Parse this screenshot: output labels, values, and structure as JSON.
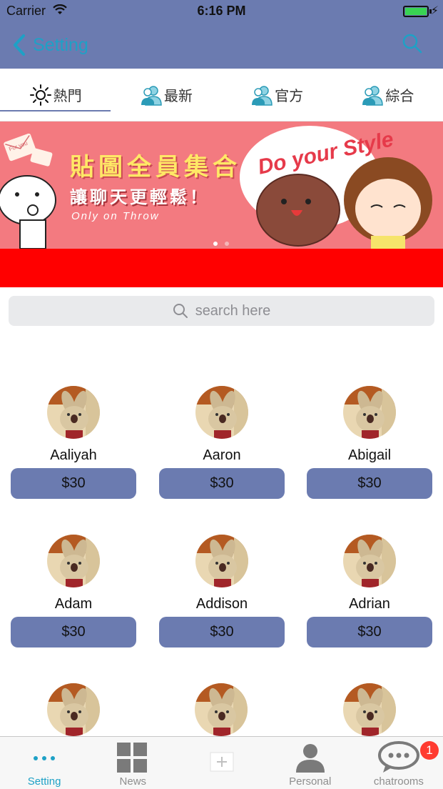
{
  "status_bar": {
    "carrier": "Carrier",
    "time": "6:16 PM"
  },
  "nav": {
    "back_label": "Setting"
  },
  "tabs": [
    {
      "label": "熱門",
      "icon": "sun-icon"
    },
    {
      "label": "最新",
      "icon": "users-icon"
    },
    {
      "label": "官方",
      "icon": "users-icon"
    },
    {
      "label": "綜合",
      "icon": "users-icon"
    }
  ],
  "banner": {
    "headline": "貼圖全員集合",
    "subline": "讓聊天更輕鬆！",
    "tagline": "Only on Throw",
    "bubble_text": "Do your Style",
    "envelope_text": "For you"
  },
  "search": {
    "placeholder": "search here"
  },
  "stickers": [
    {
      "name": "Aaliyah",
      "price": "$30"
    },
    {
      "name": "Aaron",
      "price": "$30"
    },
    {
      "name": "Abigail",
      "price": "$30"
    },
    {
      "name": "Adam",
      "price": "$30"
    },
    {
      "name": "Addison",
      "price": "$30"
    },
    {
      "name": "Adrian",
      "price": "$30"
    }
  ],
  "tabbar": {
    "items": [
      {
        "label": "Setting"
      },
      {
        "label": "News"
      },
      {
        "label": ""
      },
      {
        "label": "Personal"
      },
      {
        "label": "chatrooms",
        "badge": "1"
      }
    ]
  },
  "colors": {
    "primary": "#6b7bb0",
    "accent": "#1ea1c6",
    "banner": "#f37a80",
    "red_bar": "#ff0000"
  }
}
